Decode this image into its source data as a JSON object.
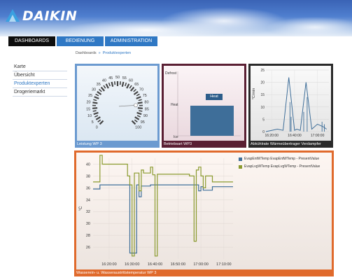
{
  "brand": {
    "name": "DAIKIN"
  },
  "nav": {
    "tabs": [
      {
        "label": "DASHBOARDS",
        "active": true
      },
      {
        "label": "BEDIENUNG",
        "active": false
      },
      {
        "label": "ADMINISTRATION",
        "active": false
      }
    ]
  },
  "breadcrumb": {
    "home": "Dashboards",
    "separator": "»",
    "current": "Produktexperten"
  },
  "sidebar": {
    "items": [
      {
        "label": "Karte",
        "active": false
      },
      {
        "label": "Übersicht",
        "active": false
      },
      {
        "label": "Produktexperten",
        "active": true
      },
      {
        "label": "Drogeriemarkt",
        "active": false
      }
    ]
  },
  "panels": {
    "gauge": {
      "title": "Leistung WP 3",
      "ticks": [
        "0",
        "5",
        "10",
        "15",
        "20",
        "25",
        "30",
        "35",
        "40",
        "45",
        "50",
        "55",
        "60",
        "65",
        "70",
        "75",
        "80",
        "85",
        "90",
        "95",
        "100"
      ],
      "value": 82,
      "colors": {
        "frame": "#6b9ad0",
        "arc": "#444444"
      }
    },
    "mode": {
      "title": "Betriebsart WP3",
      "states": {
        "top": "Defrost",
        "middle": "Heat",
        "bottom": "Ice"
      },
      "current": "Heat",
      "colors": {
        "frame": "#5a1f33",
        "bar": "#3e6e99"
      }
    },
    "evap": {
      "title": "Abkühlrate Wärmeübertrager Verdampfer",
      "ylabel": "°C/min",
      "yticks": [
        "0",
        "5",
        "10",
        "15",
        "20",
        "25"
      ],
      "xticks": [
        "16:20:00",
        "16:40:00",
        "17:00:00"
      ],
      "colors": {
        "frame": "#2a2a2a",
        "line": "#3e6e99"
      }
    },
    "temp": {
      "title": "Wasserein- u. Wasseraustrittstemperatur WP 3",
      "colors": {
        "frame": "#e06a2c"
      }
    }
  },
  "chart_data": [
    {
      "type": "line",
      "title": "Abkühlrate Wärmeübertrager Verdampfer",
      "ylabel": "°C/min",
      "ylim": [
        0,
        25
      ],
      "x": [
        "16:15",
        "16:20",
        "16:25",
        "16:30",
        "16:35",
        "16:40",
        "16:42",
        "16:45",
        "16:50",
        "16:55",
        "17:00",
        "17:05",
        "17:08"
      ],
      "series": [
        {
          "name": "",
          "values": [
            0,
            0.5,
            1,
            0.5,
            22,
            0.5,
            1,
            0.5,
            20,
            1,
            3,
            2,
            1
          ]
        }
      ],
      "grid": true
    },
    {
      "type": "line",
      "title": "Wasserein- u. Wasseraustrittstemperatur WP 3",
      "ylabel": "°C",
      "ylim": [
        24,
        41
      ],
      "xticks": [
        "16:20:00",
        "16:30:00",
        "16:40:00",
        "16:50:00",
        "17:00:00",
        "17:10:00"
      ],
      "legend": "top-right",
      "series": [
        {
          "name": "EvapEntWTemp EvapEntWTemp - PresentValue",
          "color": "#3e6e99",
          "x": [
            "16:13",
            "16:15",
            "16:16",
            "16:26",
            "16:28",
            "16:29",
            "16:32",
            "16:33",
            "16:34",
            "16:37",
            "16:38",
            "16:39",
            "16:45",
            "16:55",
            "16:58",
            "16:59",
            "17:00",
            "17:01",
            "17:05",
            "17:14"
          ],
          "values": [
            35.8,
            35.8,
            36.5,
            36.5,
            36.5,
            25,
            36.5,
            34.5,
            36.3,
            36.3,
            36.5,
            36.5,
            36.5,
            36.5,
            36.5,
            35.5,
            36.2,
            35.6,
            36.2,
            36.2
          ]
        },
        {
          "name": "EvapLvgWTemp EvapLvgWTemp - PresentValue",
          "color": "#8a9a2e",
          "x": [
            "16:13",
            "16:14",
            "16:16",
            "16:17",
            "16:27",
            "16:28",
            "16:29",
            "16:30",
            "16:31",
            "16:33",
            "16:34",
            "16:35",
            "16:38",
            "16:39",
            "16:40",
            "16:41",
            "16:52",
            "16:55",
            "16:56",
            "16:57",
            "16:58",
            "16:59",
            "17:00",
            "17:01",
            "17:02",
            "17:05",
            "17:14"
          ],
          "values": [
            37,
            37,
            41.5,
            40,
            40,
            38,
            36.5,
            24.5,
            38.5,
            35.5,
            39,
            38.5,
            39.5,
            38.2,
            24.5,
            38.3,
            38.3,
            38,
            38,
            27,
            39,
            39.5,
            38,
            36,
            38,
            37,
            37
          ]
        }
      ],
      "grid": true
    }
  ]
}
